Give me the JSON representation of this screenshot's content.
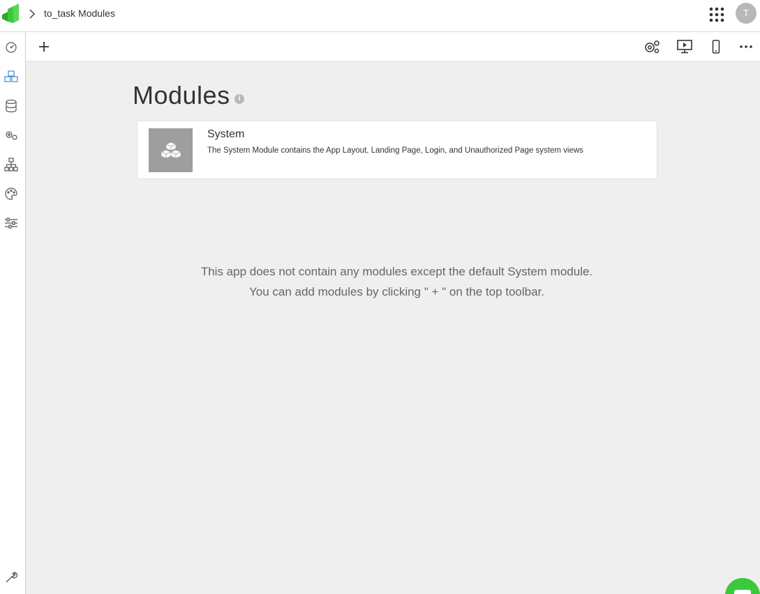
{
  "header": {
    "breadcrumb_page": "to_task Modules",
    "user_initial": "T"
  },
  "sidebar": {
    "items": [
      {
        "name": "dashboard"
      },
      {
        "name": "modules"
      },
      {
        "name": "data"
      },
      {
        "name": "services"
      },
      {
        "name": "hierarchy"
      },
      {
        "name": "style"
      },
      {
        "name": "settings"
      }
    ]
  },
  "main": {
    "title": "Modules",
    "info_glyph": "i",
    "modules": [
      {
        "name": "System",
        "description": "The System Module contains the App Layout, Landing Page, Login, and Unauthorized Page system views"
      }
    ],
    "empty_line1": "This app does not contain any modules except the default System module.",
    "empty_line2": "You can add modules by clicking \" + \" on the top toolbar."
  },
  "colors": {
    "brand": "#3cc83c",
    "active_nav": "#3a8ddb",
    "canvas": "#efefef"
  }
}
